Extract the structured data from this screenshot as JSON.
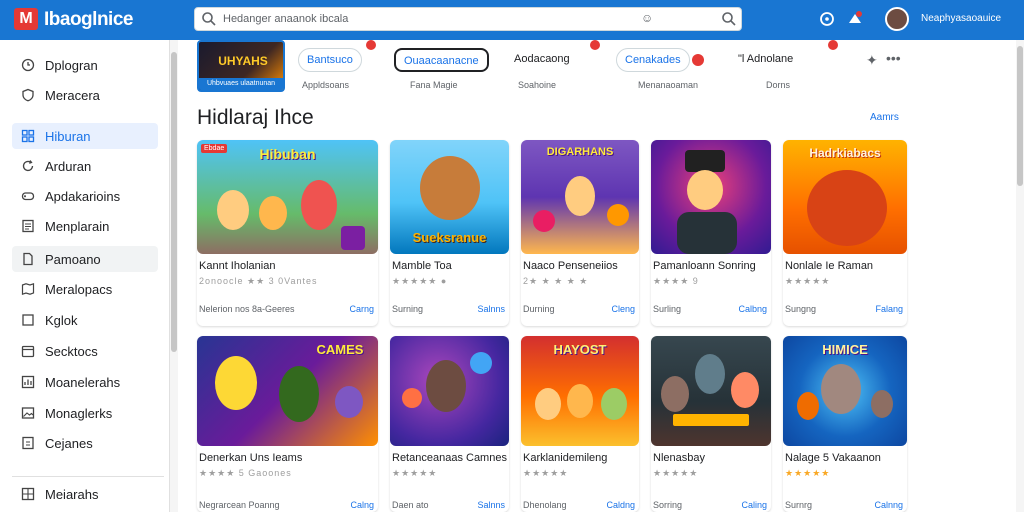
{
  "header": {
    "logo_letter": "M",
    "app_title": "Ibaoglnice",
    "search_placeholder": "Hedanger anaanok ibcala",
    "clear_glyph": "☺",
    "username": "Neaphyasaoauice"
  },
  "sidebar": {
    "items": [
      {
        "label": "Dplogran",
        "icon": "clock-icon"
      },
      {
        "label": "Meracera",
        "icon": "shield-icon"
      },
      {
        "label": "Hiburan",
        "icon": "grid-icon"
      },
      {
        "label": "Arduran",
        "icon": "refresh-icon"
      },
      {
        "label": "Apdakarioins",
        "icon": "gamepad-icon"
      },
      {
        "label": "Menplarain",
        "icon": "list-icon"
      },
      {
        "label": "Pamoano",
        "icon": "document-icon"
      },
      {
        "label": "Meralopacs",
        "icon": "map-icon"
      },
      {
        "label": "Kglok",
        "icon": "checkbox-icon"
      },
      {
        "label": "Secktocs",
        "icon": "calendar-icon"
      },
      {
        "label": "Moanelerahs",
        "icon": "chart-icon"
      },
      {
        "label": "Monaglerks",
        "icon": "image-icon"
      },
      {
        "label": "Cejanes",
        "icon": "info-icon"
      },
      {
        "label": "Meiarahs",
        "icon": "grid-icon"
      }
    ]
  },
  "categories": [
    {
      "title": "UHYAHS",
      "subtitle": "Uhbvuaes ulaatnunan"
    },
    {
      "chip": "Bantsuco",
      "subtitle": "Appldsoans"
    },
    {
      "chip": "Ouaacaanacne",
      "subtitle": "Fana Magie"
    },
    {
      "chip": "Aodacaong",
      "subtitle": "Soahoine"
    },
    {
      "chip": "Cenakades",
      "subtitle": "Menanaoaman"
    },
    {
      "chip": "\"l Adnolane",
      "subtitle": "Dorns"
    }
  ],
  "section": {
    "title": "Hidlaraj Ihce",
    "see_all": "Aamrs"
  },
  "cards": [
    {
      "thumb_title": "Hibuban",
      "badge": "Ebdae",
      "name": "Kannt Iholanian",
      "stars": "2onoocle ★★ 3 0Vantes",
      "meta": "Nelerion nos 8a-Geeres",
      "action": "Carng"
    },
    {
      "thumb_title": "Sueksranue",
      "name": "Mamble Toa",
      "stars": "★★★★★ ●",
      "meta": "Surning",
      "action": "Salnns"
    },
    {
      "thumb_title": "DIGARHANS",
      "name": "Naaco Penseneiios",
      "stars": "2★ ★ ★ ★ ★",
      "meta": "Durning",
      "action": "Cleng"
    },
    {
      "thumb_title": "",
      "name": "Pamanloann Sonring",
      "stars": "★★★★ 9",
      "meta": "Surling",
      "action": "Calbng"
    },
    {
      "thumb_title": "Hadrkiabacs",
      "name": "Nonlale Ie Raman",
      "stars": "★★★★★",
      "meta": "Sungng",
      "action": "Falang"
    },
    {
      "thumb_title": "CAMES",
      "name": "Denerkan Uns Ieams",
      "stars": "★★★★ 5 Gaoones",
      "meta": "Negrarcean Poanng",
      "action": "Calng"
    },
    {
      "thumb_title": "",
      "name": "Retanceanaas Camnes",
      "stars": "★★★★★",
      "meta": "Daen ato",
      "action": "Salnns"
    },
    {
      "thumb_title": "HAYOST",
      "name": "Karklanidemileng",
      "stars": "★★★★★",
      "meta": "Dhenolang",
      "action": "Caldng"
    },
    {
      "thumb_title": "",
      "name": "Nlenasbay",
      "stars": "★★★★★",
      "meta": "Sorring",
      "action": "Caling"
    },
    {
      "thumb_title": "HIMICE",
      "name": "Nalage 5 Vakaanon",
      "stars": "★★★★★",
      "meta": "Surnrg",
      "action": "Calnng"
    }
  ],
  "colors": {
    "brand": "#1976d2",
    "accent": "#1a73e8",
    "badge": "#e53935"
  }
}
